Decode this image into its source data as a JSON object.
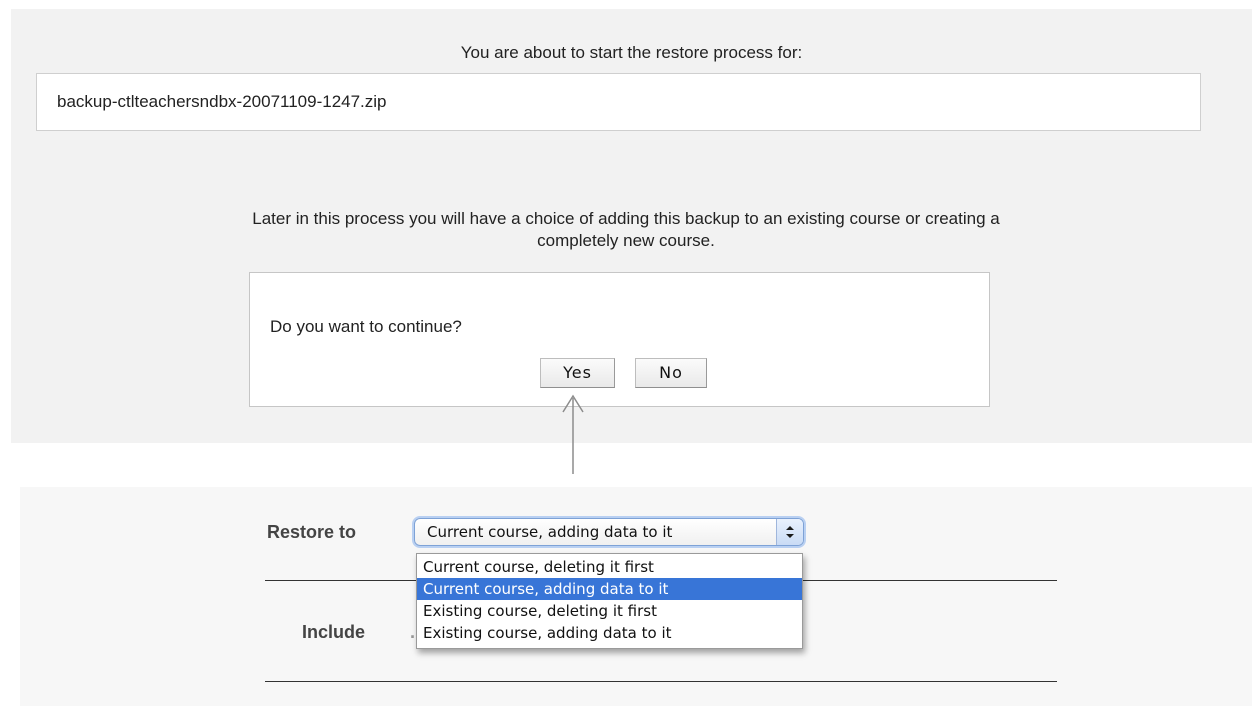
{
  "restore_notice": {
    "intro_text": "You are about to start the restore process for:",
    "filename": "backup-ctlteachersndbx-20071109-1247.zip",
    "later_line1": "Later in this process you will have a choice of adding this backup to an existing course or creating a",
    "later_line2": "completely new course."
  },
  "confirm_dialog": {
    "question": "Do you want to continue?",
    "yes_label": "Yes",
    "no_label": "No"
  },
  "restore_form": {
    "restore_to_label": "Restore to",
    "include_label": "Include",
    "select": {
      "selected_value": "Current course, adding data to it",
      "options": [
        "Current course, deleting it first",
        "Current course, adding data to it",
        "Existing course, deleting it first",
        "Existing course, adding data to it"
      ],
      "highlighted_index": 1
    }
  },
  "colors": {
    "highlight": "#3875d7",
    "panel_background": "#f2f2f2"
  },
  "icons": {
    "select_arrows": "updown-chevrons-icon",
    "pointer_arrow": "arrow-up-icon"
  }
}
